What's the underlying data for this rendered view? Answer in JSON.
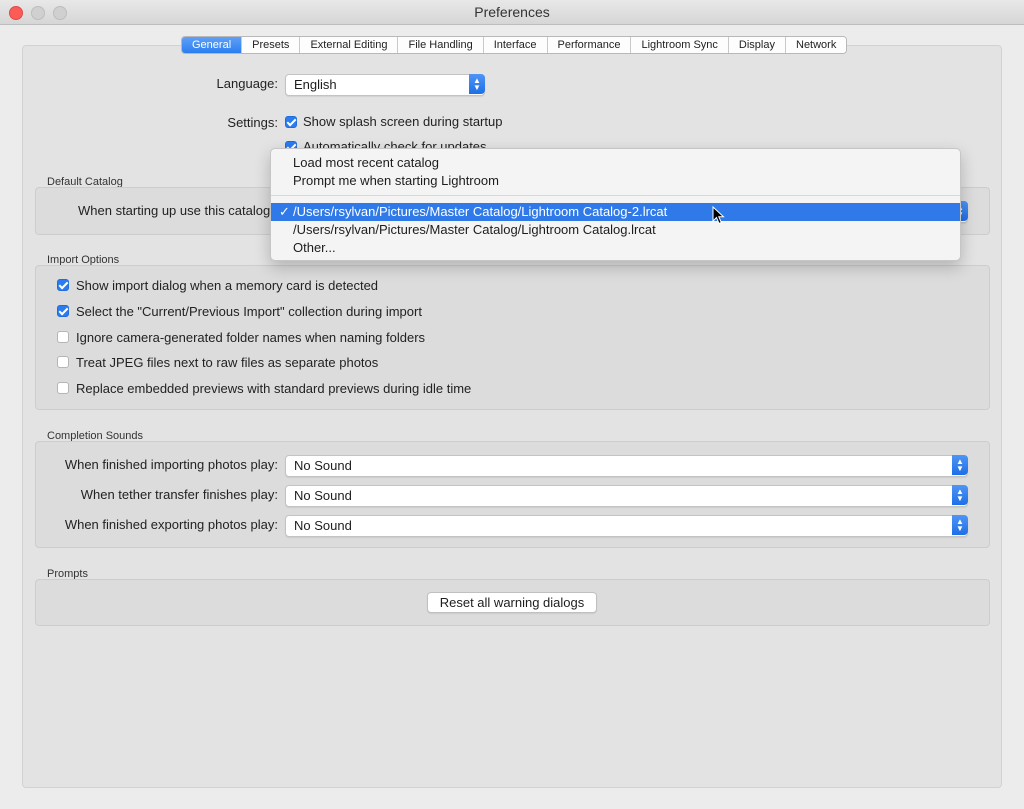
{
  "window": {
    "title": "Preferences"
  },
  "tabs": [
    {
      "label": "General",
      "active": true
    },
    {
      "label": "Presets",
      "active": false
    },
    {
      "label": "External Editing",
      "active": false
    },
    {
      "label": "File Handling",
      "active": false
    },
    {
      "label": "Interface",
      "active": false
    },
    {
      "label": "Performance",
      "active": false
    },
    {
      "label": "Lightroom Sync",
      "active": false
    },
    {
      "label": "Display",
      "active": false
    },
    {
      "label": "Network",
      "active": false
    }
  ],
  "general": {
    "language_label": "Language:",
    "language_value": "English",
    "settings_label": "Settings:",
    "splash_label": "Show splash screen during startup",
    "splash_checked": true,
    "updates_label": "Automatically check for updates",
    "updates_checked": true
  },
  "default_catalog": {
    "section_title": "Default Catalog",
    "startup_label": "When starting up use this catalog:",
    "menu": {
      "items": [
        {
          "label": "Load most recent catalog",
          "selected": false
        },
        {
          "label": "Prompt me when starting Lightroom",
          "selected": false
        },
        {
          "label": "/Users/rsylvan/Pictures/Master Catalog/Lightroom Catalog-2.lrcat",
          "selected": true
        },
        {
          "label": "/Users/rsylvan/Pictures/Master Catalog/Lightroom Catalog.lrcat",
          "selected": false
        },
        {
          "label": "Other...",
          "selected": false
        }
      ],
      "check_mark": "✓"
    }
  },
  "import_options": {
    "section_title": "Import Options",
    "options": [
      {
        "label": "Show import dialog when a memory card is detected",
        "checked": true
      },
      {
        "label": "Select the \"Current/Previous Import\" collection during import",
        "checked": true
      },
      {
        "label": "Ignore camera-generated folder names when naming folders",
        "checked": false
      },
      {
        "label": "Treat JPEG files next to raw files as separate photos",
        "checked": false
      },
      {
        "label": "Replace embedded previews with standard previews during idle time",
        "checked": false
      }
    ]
  },
  "completion_sounds": {
    "section_title": "Completion Sounds",
    "rows": [
      {
        "label": "When finished importing photos play:",
        "value": "No Sound"
      },
      {
        "label": "When tether transfer finishes play:",
        "value": "No Sound"
      },
      {
        "label": "When finished exporting photos play:",
        "value": "No Sound"
      }
    ]
  },
  "prompts": {
    "section_title": "Prompts",
    "reset_button": "Reset all warning dialogs"
  },
  "icons": {
    "close": "close-icon",
    "minimize": "minimize-icon",
    "zoom": "zoom-icon",
    "popup_arrows": "up-down-chevron-icon",
    "cursor": "pointer-cursor-icon"
  },
  "colors": {
    "accent": "#2a7cf0",
    "close_button": "#fc5b57",
    "window_bg": "#ececec"
  }
}
